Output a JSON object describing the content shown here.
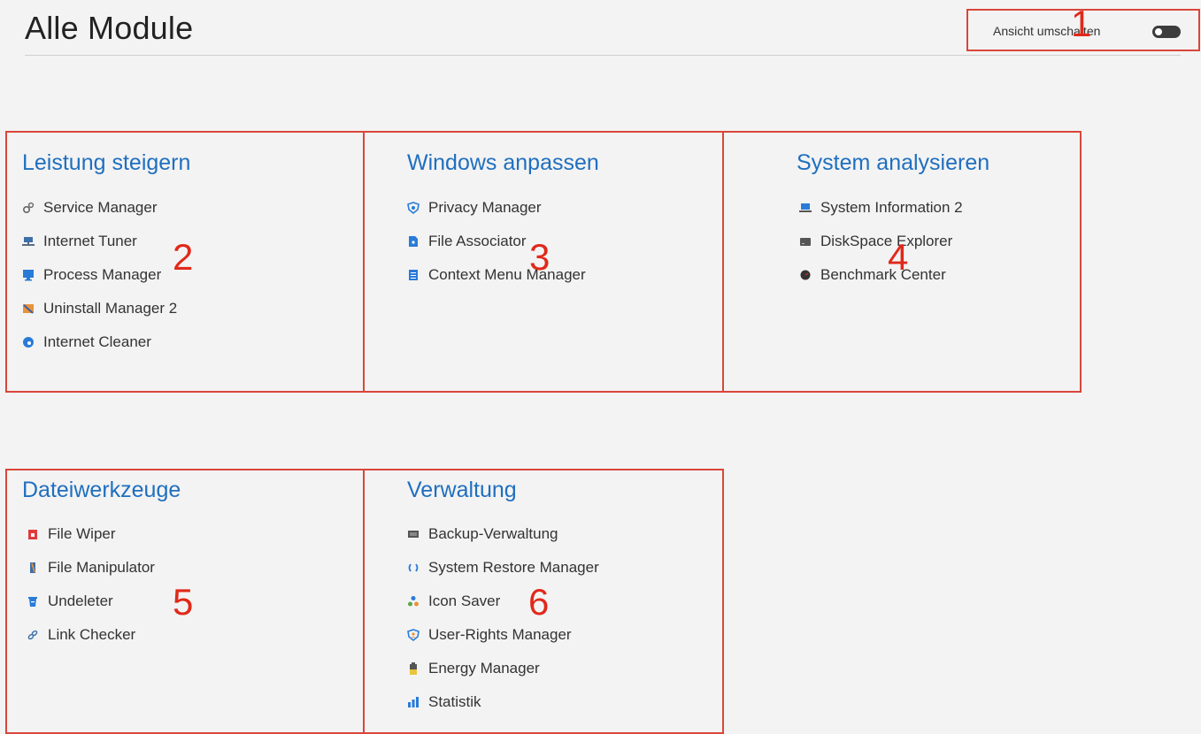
{
  "page": {
    "title": "Alle Module",
    "toggle_label": "Ansicht umschalten"
  },
  "colors": {
    "heading_blue": "#1f6fbf",
    "annotation_red": "#d9463a"
  },
  "groups": [
    {
      "title": "Leistung steigern",
      "marker": "2",
      "items": [
        {
          "label": "Service Manager",
          "icon": "gears-icon"
        },
        {
          "label": "Internet Tuner",
          "icon": "network-icon"
        },
        {
          "label": "Process Manager",
          "icon": "monitor-icon"
        },
        {
          "label": "Uninstall Manager 2",
          "icon": "uninstall-icon"
        },
        {
          "label": "Internet Cleaner",
          "icon": "globe-icon"
        }
      ]
    },
    {
      "title": "Windows anpassen",
      "marker": "3",
      "items": [
        {
          "label": "Privacy Manager",
          "icon": "shield-eye-icon"
        },
        {
          "label": "File Associator",
          "icon": "file-link-icon"
        },
        {
          "label": "Context Menu Manager",
          "icon": "menu-list-icon"
        }
      ]
    },
    {
      "title": "System analysieren",
      "marker": "4",
      "items": [
        {
          "label": "System Information 2",
          "icon": "laptop-icon"
        },
        {
          "label": "DiskSpace Explorer",
          "icon": "disk-icon"
        },
        {
          "label": "Benchmark Center",
          "icon": "gauge-icon"
        }
      ]
    },
    {
      "title": "Dateiwerkzeuge",
      "marker": "5",
      "items": [
        {
          "label": "File Wiper",
          "icon": "shredder-icon"
        },
        {
          "label": "File Manipulator",
          "icon": "file-edit-icon"
        },
        {
          "label": "Undeleter",
          "icon": "trash-restore-icon"
        },
        {
          "label": "Link Checker",
          "icon": "chain-link-icon"
        }
      ]
    },
    {
      "title": "Verwaltung",
      "marker": "6",
      "items": [
        {
          "label": "Backup-Verwaltung",
          "icon": "backup-icon"
        },
        {
          "label": "System Restore Manager",
          "icon": "restore-arrows-icon"
        },
        {
          "label": "Icon Saver",
          "icon": "icon-saver-icon"
        },
        {
          "label": "User-Rights Manager",
          "icon": "user-shield-icon"
        },
        {
          "label": "Energy Manager",
          "icon": "battery-icon"
        },
        {
          "label": "Statistik",
          "icon": "bar-chart-icon"
        }
      ]
    }
  ],
  "annotations": {
    "toggle_marker": "1"
  }
}
